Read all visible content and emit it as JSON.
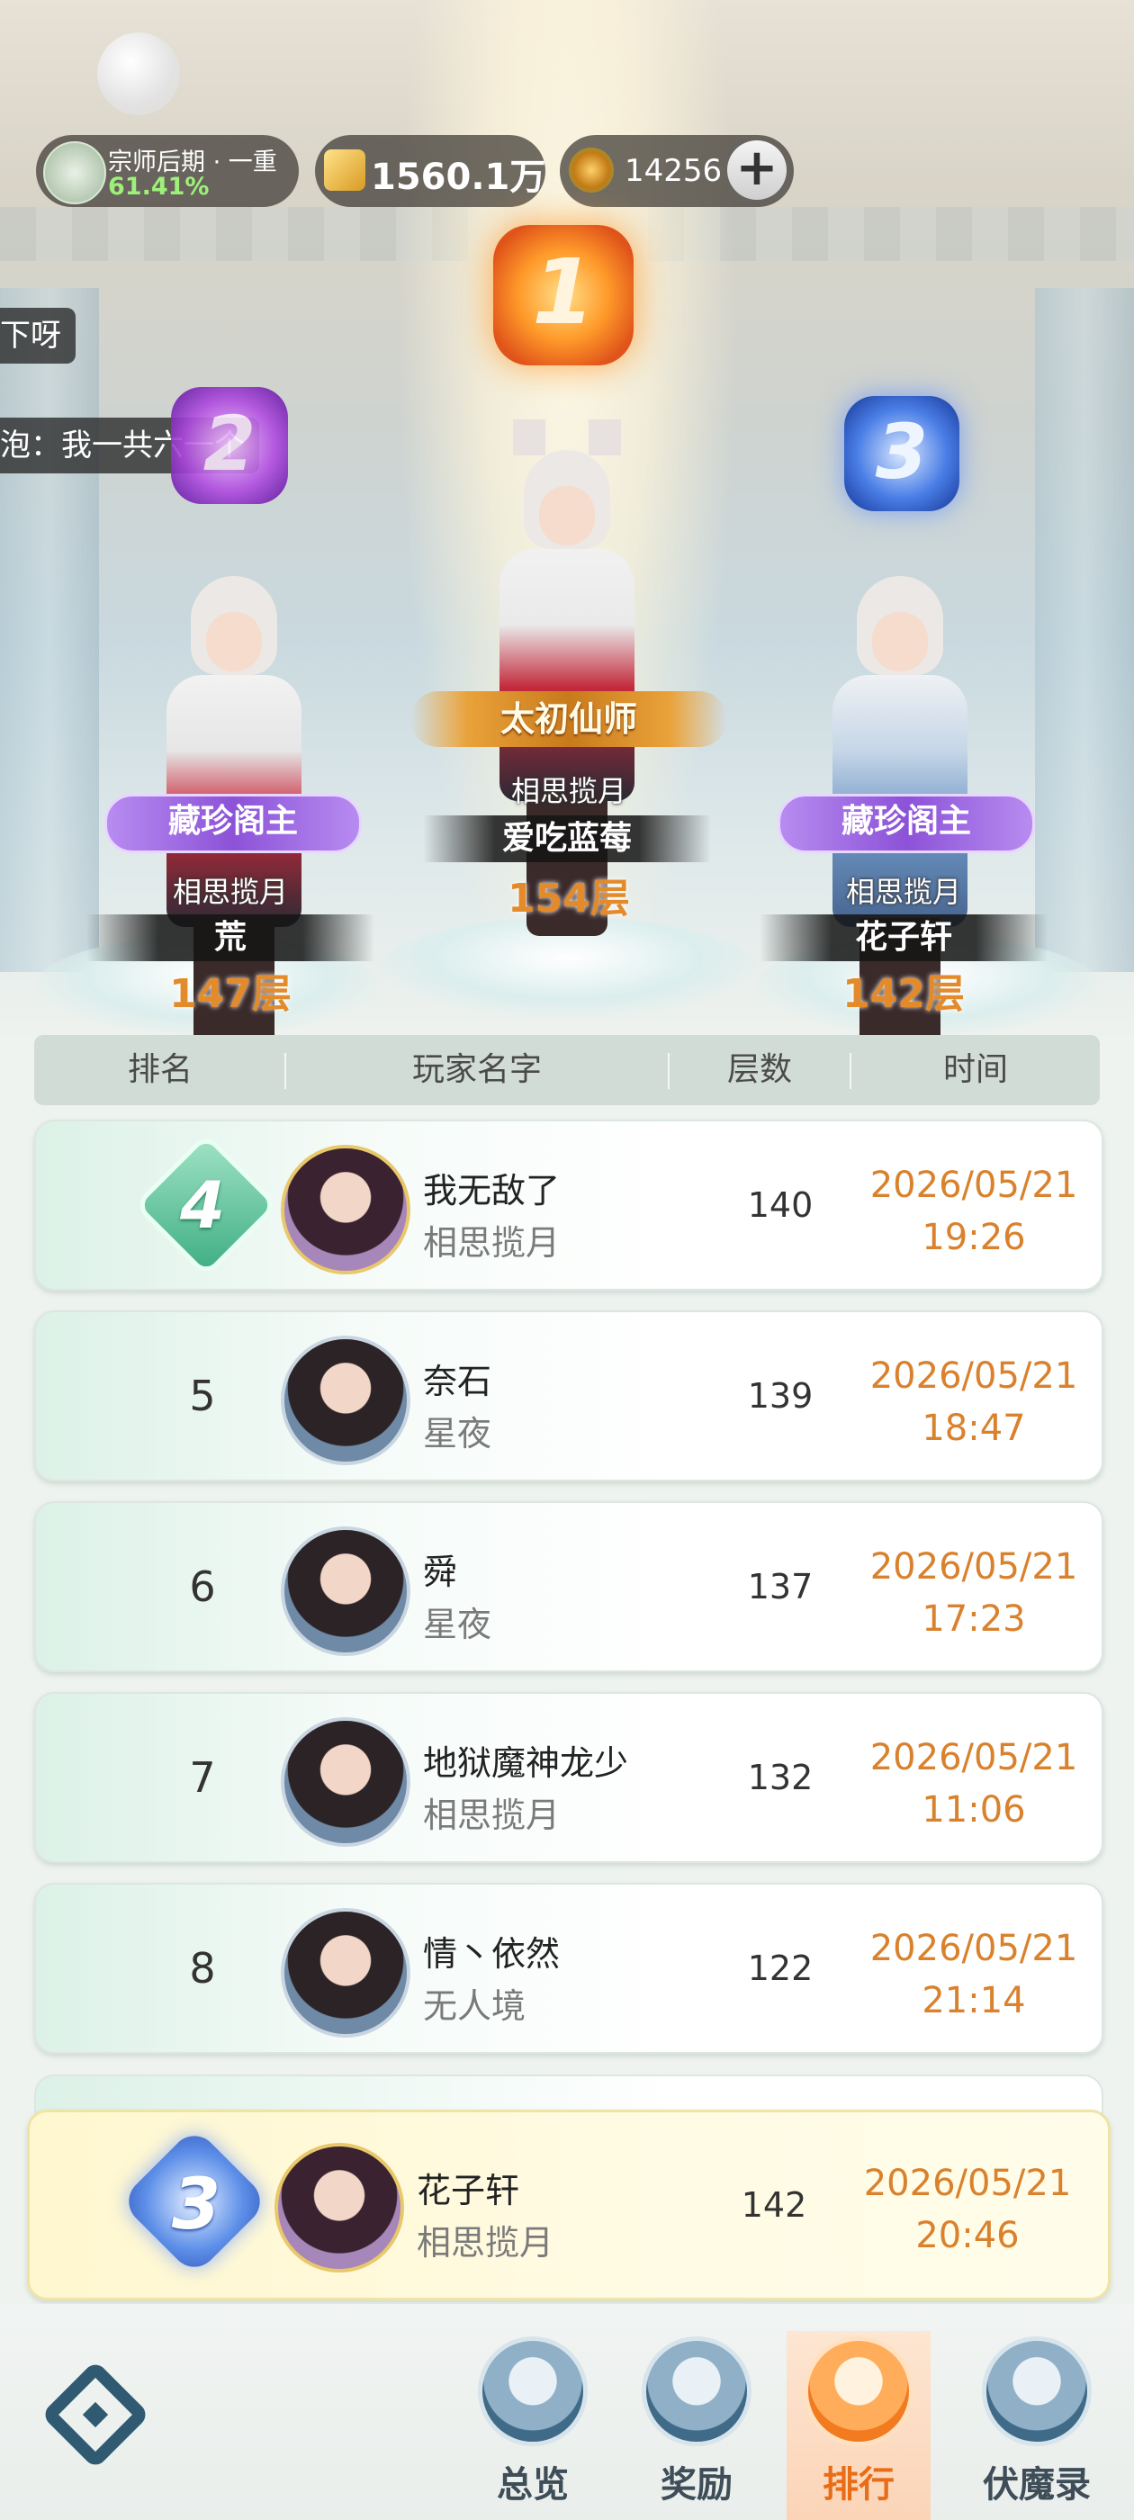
{
  "hud": {
    "realm": "宗师后期 · 一重",
    "progress": "61.41%",
    "gold": "1560.1万",
    "jade": "14256",
    "add": "+"
  },
  "chat": [
    "下呀",
    "泡：我一共六一个"
  ],
  "podium": [
    {
      "rank": "1",
      "title": "太初仙师",
      "guild": "相思揽月",
      "name": "爱吃蓝莓",
      "floor": "154层"
    },
    {
      "rank": "2",
      "title": "藏珍阁主",
      "guild": "相思揽月",
      "name": "荒",
      "floor": "147层"
    },
    {
      "rank": "3",
      "title": "藏珍阁主",
      "guild": "相思揽月",
      "name": "花子轩",
      "floor": "142层"
    }
  ],
  "table": {
    "headers": [
      "排名",
      "玩家名字",
      "层数",
      "时间"
    ],
    "rows": [
      {
        "rank": "4",
        "name": "我无敌了",
        "guild": "相思揽月",
        "floor": "140",
        "date": "2026/05/21",
        "time": "19:26"
      },
      {
        "rank": "5",
        "name": "奈石",
        "guild": "星夜",
        "floor": "139",
        "date": "2026/05/21",
        "time": "18:47"
      },
      {
        "rank": "6",
        "name": "舜",
        "guild": "星夜",
        "floor": "137",
        "date": "2026/05/21",
        "time": "17:23"
      },
      {
        "rank": "7",
        "name": "地狱魔神龙少",
        "guild": "相思揽月",
        "floor": "132",
        "date": "2026/05/21",
        "time": "11:06"
      },
      {
        "rank": "8",
        "name": "情丶依然",
        "guild": "无人境",
        "floor": "122",
        "date": "2026/05/21",
        "time": "21:14"
      }
    ],
    "mine": {
      "rank": "3",
      "name": "花子轩",
      "guild": "相思揽月",
      "floor": "142",
      "date": "2026/05/21",
      "time": "20:46"
    }
  },
  "nav": {
    "tabs": [
      "总览",
      "奖励",
      "排行",
      "伏魔录"
    ],
    "active": "排行"
  },
  "colors": {
    "accent": "#e86d16",
    "date": "#d9812c",
    "highlight_row": "#fff7cf"
  }
}
